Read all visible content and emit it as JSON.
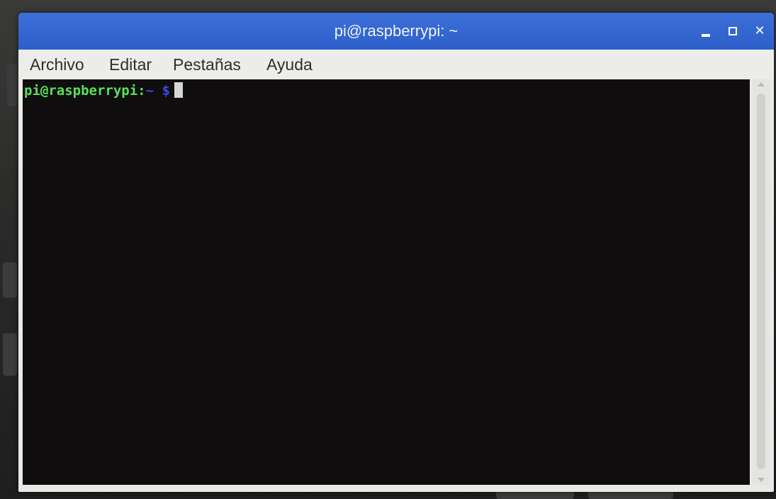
{
  "window": {
    "title": "pi@raspberrypi: ~",
    "controls": {
      "minimize_icon": "minimize-icon",
      "maximize_icon": "maximize-icon",
      "close_icon": "close-icon",
      "close_glyph": "✕"
    }
  },
  "menu": {
    "items": [
      {
        "label": "Archivo"
      },
      {
        "label": "Editar"
      },
      {
        "label": "Pestañas"
      },
      {
        "label": "Ayuda"
      }
    ]
  },
  "terminal": {
    "prompt_user": "pi@raspberrypi:",
    "prompt_path": "~",
    "prompt_symbol": "$"
  },
  "colors": {
    "titlebar": "#2c5fc9",
    "terminal_bg": "#0f0d0d",
    "prompt_user": "#58e05a",
    "prompt_path": "#3a46e8"
  }
}
